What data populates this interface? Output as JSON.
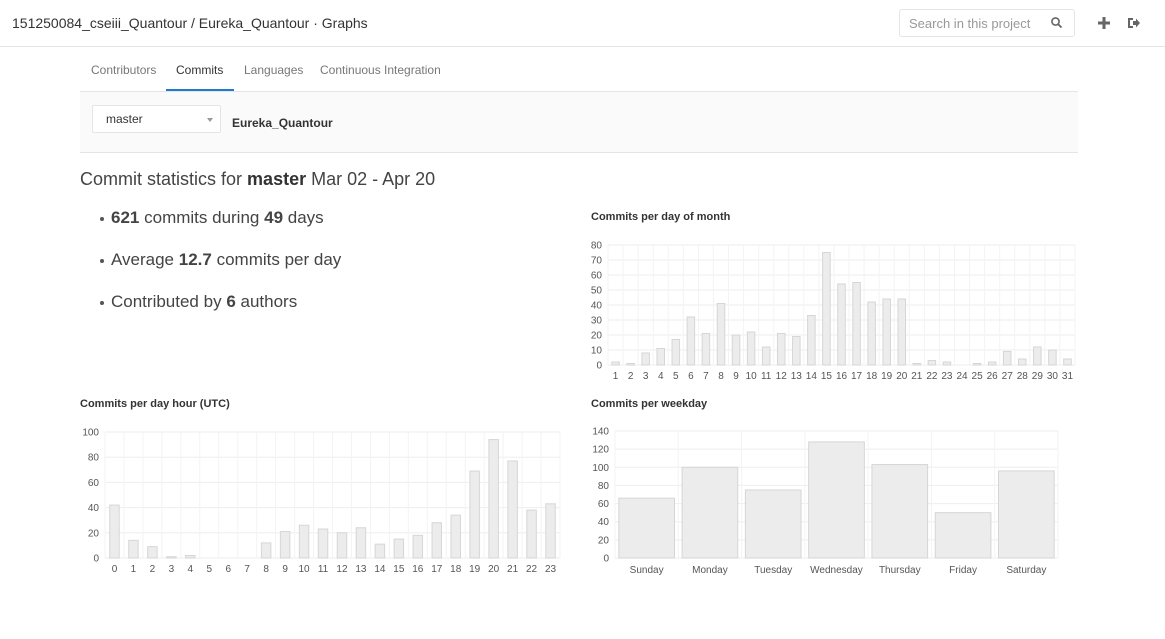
{
  "header": {
    "title": "151250084_cseiii_Quantour / Eureka_Quantour · Graphs",
    "search_placeholder": "Search in this project",
    "icons": [
      "search-icon",
      "plus-icon",
      "sign-out-icon"
    ]
  },
  "tabs": [
    {
      "label": "Contributors",
      "active": false
    },
    {
      "label": "Commits",
      "active": true
    },
    {
      "label": "Languages",
      "active": false
    },
    {
      "label": "Continuous Integration",
      "active": false
    }
  ],
  "filter": {
    "branch": "master",
    "project": "Eureka_Quantour"
  },
  "summary": {
    "prefix": "Commit statistics for",
    "branch": "master",
    "range": "Mar 02 - Apr 20",
    "commits": "621",
    "commits_mid": "commits during",
    "days": "49",
    "days_suffix": "days",
    "avg_prefix": "Average",
    "avg": "12.7",
    "avg_suffix": "commits per day",
    "authors_prefix": "Contributed by",
    "authors": "6",
    "authors_suffix": "authors"
  },
  "chart_data": [
    {
      "type": "bar",
      "title": "Commits per day of month",
      "categories": [
        "1",
        "2",
        "3",
        "4",
        "5",
        "6",
        "7",
        "8",
        "9",
        "10",
        "11",
        "12",
        "13",
        "14",
        "15",
        "16",
        "17",
        "18",
        "19",
        "20",
        "21",
        "22",
        "23",
        "24",
        "25",
        "26",
        "27",
        "28",
        "29",
        "30",
        "31"
      ],
      "values": [
        2,
        1,
        8,
        11,
        17,
        32,
        21,
        41,
        20,
        22,
        12,
        21,
        19,
        33,
        75,
        54,
        55,
        42,
        44,
        44,
        1,
        3,
        2,
        0,
        1,
        2,
        9,
        4,
        12,
        10,
        4
      ],
      "ylim": [
        0,
        80
      ],
      "yticks": [
        0,
        10,
        20,
        30,
        40,
        50,
        60,
        70,
        80
      ],
      "grid": true,
      "bar_fill": "#ececec",
      "bar_stroke": "#d6d6d6"
    },
    {
      "type": "bar",
      "title": "Commits per day hour (UTC)",
      "categories": [
        "0",
        "1",
        "2",
        "3",
        "4",
        "5",
        "6",
        "7",
        "8",
        "9",
        "10",
        "11",
        "12",
        "13",
        "14",
        "15",
        "16",
        "17",
        "18",
        "19",
        "20",
        "21",
        "22",
        "23"
      ],
      "values": [
        42,
        14,
        9,
        1,
        2,
        0,
        0,
        0,
        12,
        21,
        26,
        23,
        20,
        24,
        11,
        15,
        18,
        28,
        34,
        69,
        94,
        77,
        38,
        43
      ],
      "ylim": [
        0,
        100
      ],
      "yticks": [
        0,
        20,
        40,
        60,
        80,
        100
      ],
      "grid": true,
      "bar_fill": "#ececec",
      "bar_stroke": "#d6d6d6"
    },
    {
      "type": "bar",
      "title": "Commits per weekday",
      "categories": [
        "Sunday",
        "Monday",
        "Tuesday",
        "Wednesday",
        "Thursday",
        "Friday",
        "Saturday"
      ],
      "values": [
        66,
        100,
        75,
        128,
        103,
        50,
        96
      ],
      "ylim": [
        0,
        140
      ],
      "yticks": [
        0,
        20,
        40,
        60,
        80,
        100,
        120,
        140
      ],
      "grid": true,
      "bar_fill": "#ececec",
      "bar_stroke": "#d6d6d6"
    }
  ]
}
